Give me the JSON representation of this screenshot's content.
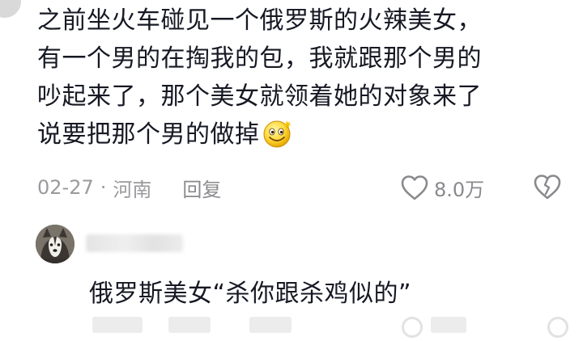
{
  "comment": {
    "lines": [
      "之前坐火车碰见一个俄罗斯的火辣美女，",
      "有一个男的在掏我的包，我就跟那个男的",
      "吵起来了，那个美女就领着她的对象来了",
      "说要把那个男的做掉"
    ],
    "emoji": "smiling-face-emoji",
    "date": "02-27",
    "separator": "·",
    "location": "河南",
    "reply_label": "回复",
    "like_count": "8.0万"
  },
  "reply": {
    "text": "俄罗斯美女“杀你跟杀鸡似的”"
  },
  "icons": {
    "like": "heart-outline-icon",
    "dislike": "broken-heart-icon"
  },
  "colors": {
    "text": "#161823",
    "meta": "#9a9a9e",
    "background": "#ffffff"
  }
}
